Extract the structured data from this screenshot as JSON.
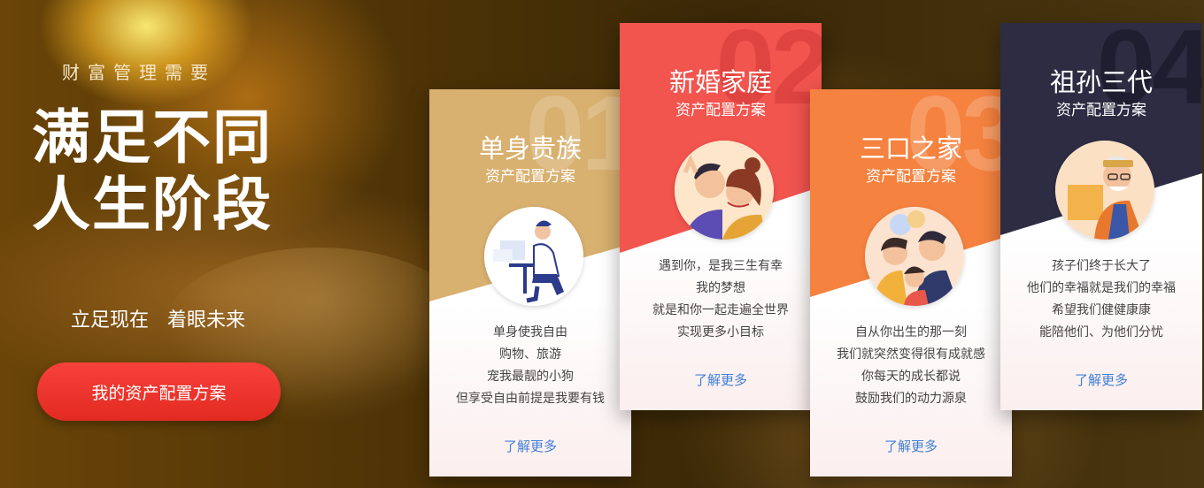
{
  "hero": {
    "subtitle": "财富管理需要",
    "title_line1": "满足不同",
    "title_line2": "人生阶段",
    "slogan": "立足现在   着眼未来",
    "cta_label": "我的资产配置方案"
  },
  "cards": [
    {
      "number": "01",
      "name": "单身贵族",
      "plan": "资产配置方案",
      "lines": [
        "单身使我自由",
        "购物、旅游",
        "宠我最靓的小狗",
        "但享受自由前提是我要有钱"
      ],
      "more": "了解更多",
      "color": "#d8b06f"
    },
    {
      "number": "02",
      "name": "新婚家庭",
      "plan": "资产配置方案",
      "lines": [
        "遇到你，是我三生有幸",
        "我的梦想",
        "就是和你一起走遍全世界",
        "实现更多小目标"
      ],
      "more": "了解更多",
      "color": "#f2544e"
    },
    {
      "number": "03",
      "name": "三口之家",
      "plan": "资产配置方案",
      "lines": [
        "自从你出生的那一刻",
        "我们就突然变得很有成就感",
        "你每天的成长都说",
        "鼓励我们的动力源泉"
      ],
      "more": "了解更多",
      "color": "#f5823f"
    },
    {
      "number": "04",
      "name": "祖孙三代",
      "plan": "资产配置方案",
      "lines": [
        "孩子们终于长大了",
        "他们的幸福就是我们的幸福",
        "希望我们健健康康",
        "能陪他们、为他们分忧"
      ],
      "more": "了解更多",
      "color": "#2d2c43"
    }
  ]
}
